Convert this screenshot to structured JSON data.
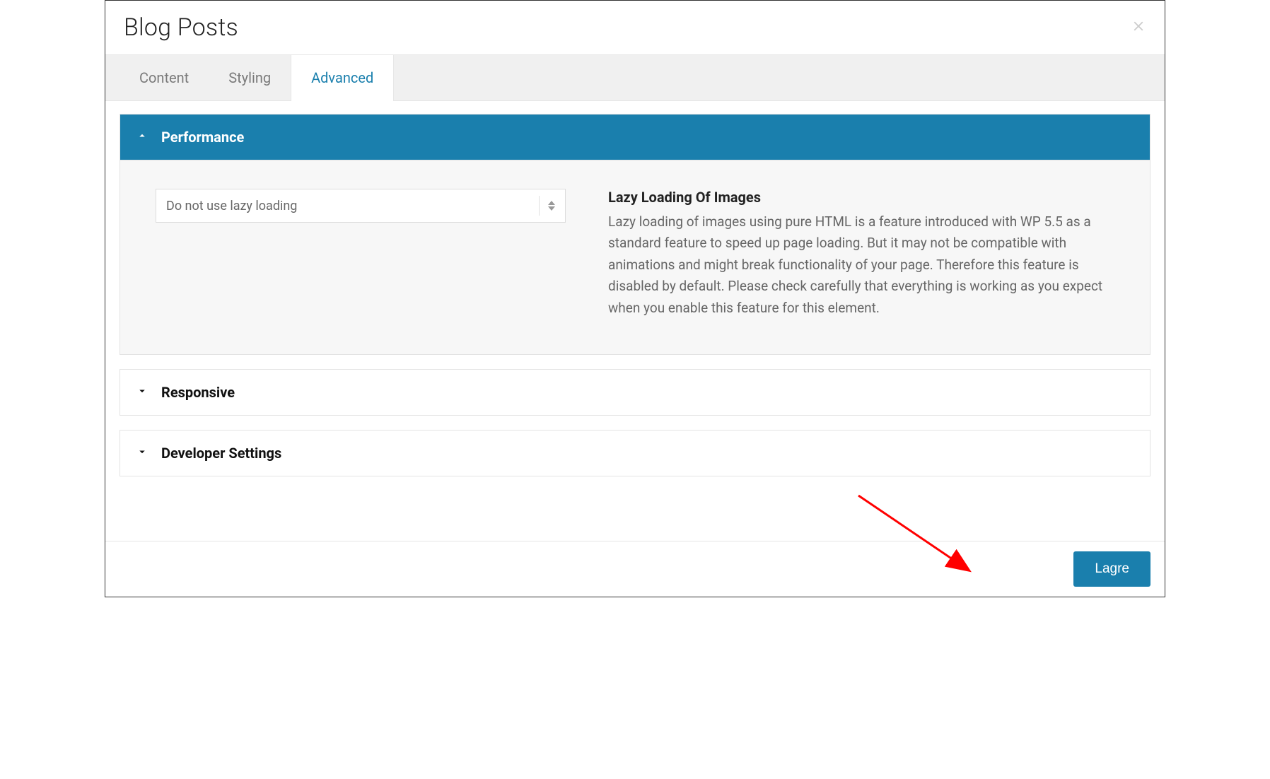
{
  "modal": {
    "title": "Blog Posts"
  },
  "tabs": [
    {
      "label": "Content",
      "active": false
    },
    {
      "label": "Styling",
      "active": false
    },
    {
      "label": "Advanced",
      "active": true
    }
  ],
  "panels": {
    "performance": {
      "title": "Performance",
      "expanded": true,
      "select_value": "Do not use lazy loading",
      "field_title": "Lazy Loading Of Images",
      "field_desc": "Lazy loading of images using pure HTML is a feature introduced with WP 5.5 as a standard feature to speed up page loading. But it may not be compatible with animations and might break functionality of your page. Therefore this feature is disabled by default. Please check carefully that everything is working as you expect when you enable this feature for this element."
    },
    "responsive": {
      "title": "Responsive",
      "expanded": false
    },
    "developer": {
      "title": "Developer Settings",
      "expanded": false
    }
  },
  "footer": {
    "save_label": "Lagre"
  }
}
